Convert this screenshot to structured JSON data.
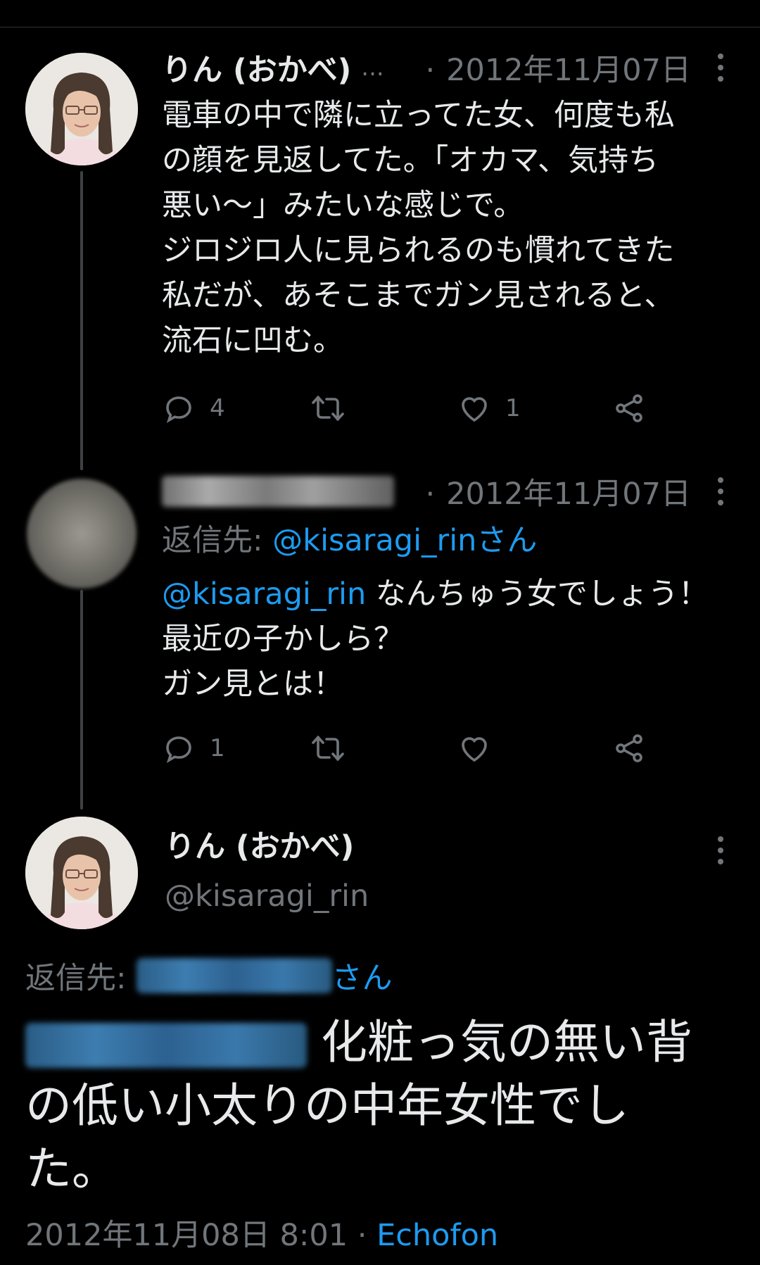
{
  "tweets": [
    {
      "name": "りん (おかべ)",
      "name_truncation": "...",
      "date": "2012年11月07日",
      "lines": [
        "電車の中で隣に立ってた女、何度も私",
        "の顔を見返してた。「オカマ、気持ち",
        "悪い〜」みたいな感じで。",
        "ジロジロ人に見られるのも慣れてきた",
        "私だが、あそこまでガン見されると、",
        "流石に凹む。"
      ],
      "reply_count": "4",
      "retweet_count": "",
      "like_count": "1"
    },
    {
      "date": "2012年11月07日",
      "reply_to_label": "返信先:",
      "reply_to_target": "@kisaragi_rinさん",
      "mention": "@kisaragi_rin",
      "lines": [
        "なんちゅう女でしょう！",
        "最近の子かしら？",
        "ガン見とは！"
      ],
      "reply_count": "1",
      "retweet_count": "",
      "like_count": ""
    }
  ],
  "main_tweet": {
    "name": "りん (おかべ)",
    "handle": "@kisaragi_rin",
    "reply_to_label": "返信先:",
    "reply_to_suffix": "さん",
    "lines": [
      "化粧っ気の無い背",
      "の低い小太りの中年女性でし",
      "た。"
    ],
    "date_time": "2012年11月08日 8:01",
    "separator": "·",
    "client": "Echofon"
  },
  "icons": {
    "reply": "reply-icon",
    "retweet": "retweet-icon",
    "like": "heart-icon",
    "share": "share-icon",
    "more": "more-icon"
  },
  "colors": {
    "background": "#000000",
    "text": "#e7e9ea",
    "muted": "#71767b",
    "link": "#1d9bf0"
  }
}
